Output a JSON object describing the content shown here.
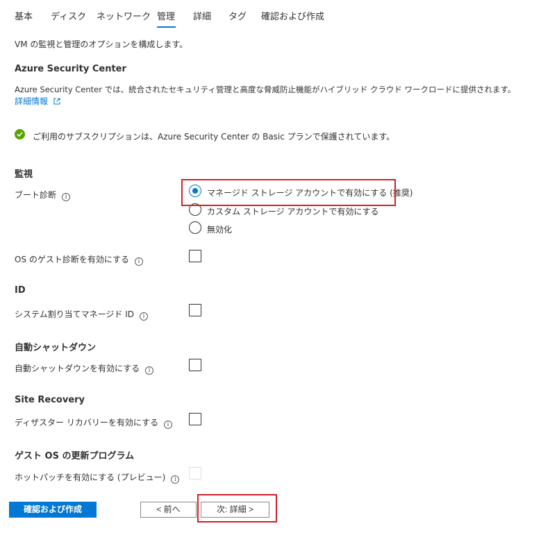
{
  "tabs": [
    {
      "label": "基本",
      "active": false
    },
    {
      "label": "ディスク",
      "active": false
    },
    {
      "label": "ネットワーク",
      "active": false
    },
    {
      "label": "管理",
      "active": true
    },
    {
      "label": "詳細",
      "active": false
    },
    {
      "label": "タグ",
      "active": false
    },
    {
      "label": "確認および作成",
      "active": false
    }
  ],
  "intro": "VM の監視と管理のオプションを構成します。",
  "security_center": {
    "heading": "Azure Security Center",
    "description": "Azure Security Center では、統合されたセキュリティ管理と高度な脅威防止機能がハイブリッド クラウド ワークロードに提供されます。",
    "link": "詳細情報",
    "status": "ご利用のサブスクリプションは、Azure Security Center の Basic プランで保護されています。"
  },
  "monitoring": {
    "heading": "監視",
    "boot_diag_label": "ブート診断",
    "boot_diag_options": [
      {
        "label": "マネージド ストレージ アカウントで有効にする (推奨)",
        "selected": true
      },
      {
        "label": "カスタム ストレージ アカウントで有効にする",
        "selected": false
      },
      {
        "label": "無効化",
        "selected": false
      }
    ],
    "guest_diag_label": "OS のゲスト診断を有効にする",
    "guest_diag_checked": false
  },
  "identity": {
    "heading": "ID",
    "label": "システム割り当てマネージド ID",
    "checked": false
  },
  "auto_shutdown": {
    "heading": "自動シャットダウン",
    "label": "自動シャットダウンを有効にする",
    "checked": false
  },
  "site_recovery": {
    "heading": "Site Recovery",
    "label": "ディザスター リカバリーを有効にする",
    "checked": false
  },
  "guest_os_update": {
    "heading": "ゲスト OS の更新プログラム",
    "label": "ホットパッチを有効にする (プレビュー)",
    "checked": false,
    "disabled": true
  },
  "footer": {
    "review_create": "確認および作成",
    "prev": "< 前へ",
    "next": "次: 詳細 >"
  },
  "colors": {
    "accent": "#0078d4",
    "success": "#57a300",
    "highlight": "#d11f2a"
  }
}
